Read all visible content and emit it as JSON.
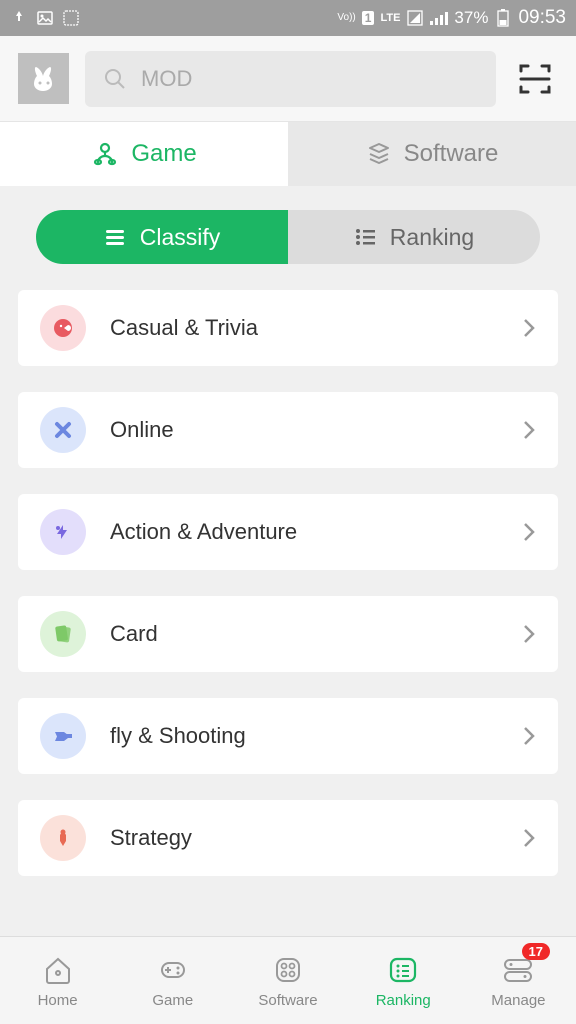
{
  "status": {
    "time": "09:53",
    "battery": "37%",
    "lte": "LTE",
    "vo": "Vo))",
    "sim": "1"
  },
  "search": {
    "placeholder": "MOD"
  },
  "main_tabs": {
    "game": "Game",
    "software": "Software"
  },
  "sub_tabs": {
    "classify": "Classify",
    "ranking": "Ranking"
  },
  "categories": [
    {
      "label": "Casual & Trivia",
      "icon_bg": "#fbdcde",
      "icon_fg": "#e85a61"
    },
    {
      "label": "Online",
      "icon_bg": "#dbe5fb",
      "icon_fg": "#6c87e0"
    },
    {
      "label": "Action & Adventure",
      "icon_bg": "#e3defb",
      "icon_fg": "#7a68e0"
    },
    {
      "label": "Card",
      "icon_bg": "#def3d9",
      "icon_fg": "#7ec968"
    },
    {
      "label": "fly & Shooting",
      "icon_bg": "#dbe5fb",
      "icon_fg": "#6c87e0"
    },
    {
      "label": "Strategy",
      "icon_bg": "#fbe1da",
      "icon_fg": "#e86a54"
    }
  ],
  "nav": {
    "home": "Home",
    "game": "Game",
    "software": "Software",
    "ranking": "Ranking",
    "manage": "Manage",
    "badge": "17"
  }
}
